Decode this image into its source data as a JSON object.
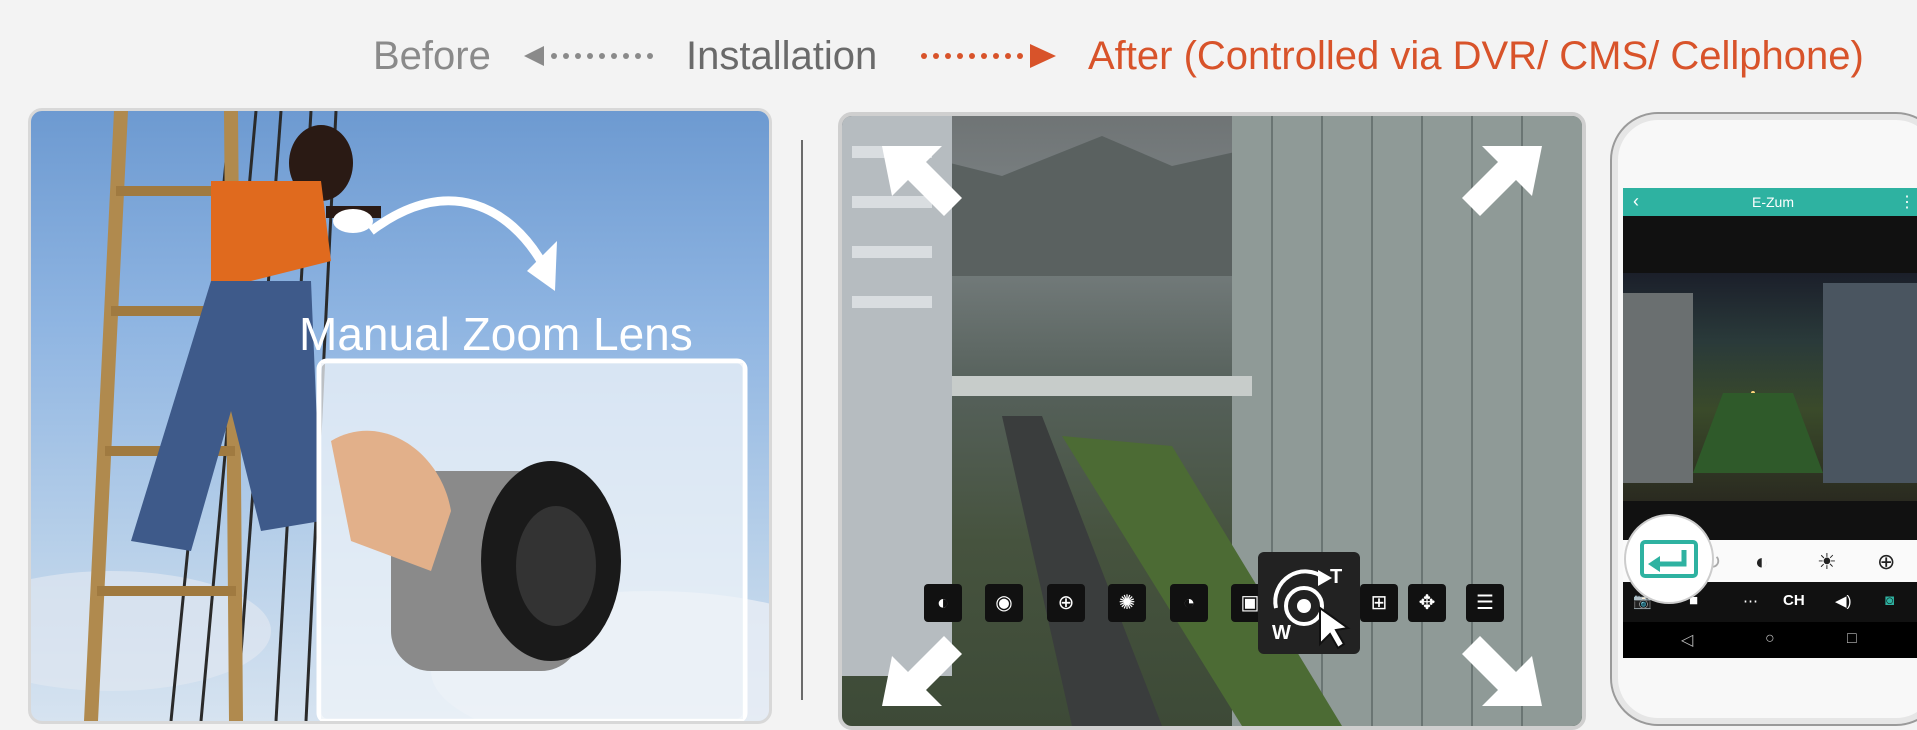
{
  "header": {
    "before": "Before",
    "installation": "Installation",
    "after": "After (Controlled via DVR/ CMS/ Cellphone)"
  },
  "left_panel": {
    "caption": "Manual Zoom Lens"
  },
  "toolbar": {
    "zoom_t": "T",
    "zoom_w": "W"
  },
  "phone": {
    "app_title": "E-Zum",
    "ch_label": "CH"
  },
  "colors": {
    "accent_orange": "#d8532a",
    "app_teal": "#2eb2a1"
  }
}
